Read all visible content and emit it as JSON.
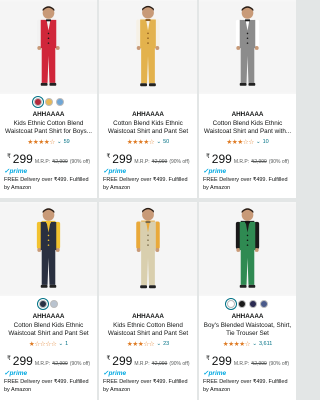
{
  "products": [
    {
      "brand": "AHHAAAA",
      "title": "Kids Ethnic Cotton Blend Waistcoat Pant Shirt for Boys...",
      "stars": "★★★★☆",
      "reviews": "59",
      "currency": "₹",
      "price": "299",
      "mrp_label": "M.R.P:",
      "mrp": "₹2,999",
      "discount": "(90% off)",
      "prime": "prime",
      "delivery": "FREE Delivery over ₹499. Fulfilled by Amazon",
      "swatches": [
        "#b22a3c",
        "#e8b957",
        "#6fa6d6"
      ],
      "colors": {
        "shirt": "#f2f2f2",
        "vest": "#d0263a",
        "pants": "#d0263a",
        "accent": "#1a1a1a"
      }
    },
    {
      "brand": "AHHAAAA",
      "title": "Cotton Blend Kids Ethnic Waistcoat Shirt and Pant Set fo...",
      "stars": "★★★★☆",
      "reviews": "50",
      "currency": "₹",
      "price": "299",
      "mrp_label": "M.R.P:",
      "mrp": "₹2,999",
      "discount": "(90% off)",
      "prime": "prime",
      "delivery": "FREE Delivery over ₹499. Fulfilled by Amazon",
      "swatches": [],
      "colors": {
        "shirt": "#f6f1e6",
        "vest": "#e3b24d",
        "pants": "#e3b24d",
        "accent": "#8b5a1e"
      }
    },
    {
      "brand": "AHHAAAA",
      "title": "Cotton Blend Kids Ethnic Waistcoat Shirt and Pant with...",
      "stars": "★★★☆☆",
      "reviews": "10",
      "currency": "₹",
      "price": "299",
      "mrp_label": "M.R.P:",
      "mrp": "₹2,999",
      "discount": "(90% off)",
      "prime": "prime",
      "delivery": "FREE Delivery over ₹499. Fulfilled by Amazon",
      "swatches": [],
      "colors": {
        "shirt": "#ffffff",
        "vest": "#8c8c8c",
        "pants": "#8c8c8c",
        "accent": "#1a1a1a"
      }
    },
    {
      "brand": "AHHAAAA",
      "title": "Cotton Blend Kids Ethnic Waistcoat Shirt and Pant Set fo...",
      "stars": "★☆☆☆☆",
      "reviews": "1",
      "currency": "₹",
      "price": "299",
      "mrp_label": "M.R.P:",
      "mrp": "₹2,999",
      "discount": "(90% off)",
      "prime": "prime",
      "delivery": "FREE Delivery over ₹499. Fulfilled by Amazon",
      "swatches": [
        "#2a3244",
        "#b9c3cf"
      ],
      "colors": {
        "shirt": "#f2c230",
        "vest": "#2a3040",
        "pants": "#2a3040",
        "accent": "#f2c230"
      }
    },
    {
      "brand": "AHHAAAA",
      "title": "Kids Ethnic Cotton Blend Waistcoat Shirt and Pant Set for...",
      "stars": "★★★☆☆",
      "reviews": "23",
      "currency": "₹",
      "price": "299",
      "mrp_label": "M.R.P:",
      "mrp": "₹2,999",
      "discount": "(90% off)",
      "prime": "prime",
      "delivery": "FREE Delivery over ₹499. Fulfilled by Amazon",
      "swatches": [],
      "colors": {
        "shirt": "#e9a93a",
        "vest": "#d9cfae",
        "pants": "#d9cfae",
        "accent": "#7a6a48"
      }
    },
    {
      "brand": "AHHAAAA",
      "title": "Boy's Blended Waistcoat, Shirt, Tie Trouser Set",
      "stars": "★★★★☆",
      "reviews": "3,611",
      "currency": "₹",
      "price": "299",
      "mrp_label": "M.R.P:",
      "mrp": "₹2,999",
      "discount": "(90% off)",
      "prime": "prime",
      "delivery": "FREE Delivery over ₹499. Fulfilled by Amazon",
      "swatches": [
        "#ffffff",
        "#1a1a1a",
        "#2b2b52",
        "#4a5a8a"
      ],
      "colors": {
        "shirt": "#1a1a1a",
        "vest": "#2f8a52",
        "pants": "#2f8a52",
        "accent": "#111111"
      }
    }
  ]
}
